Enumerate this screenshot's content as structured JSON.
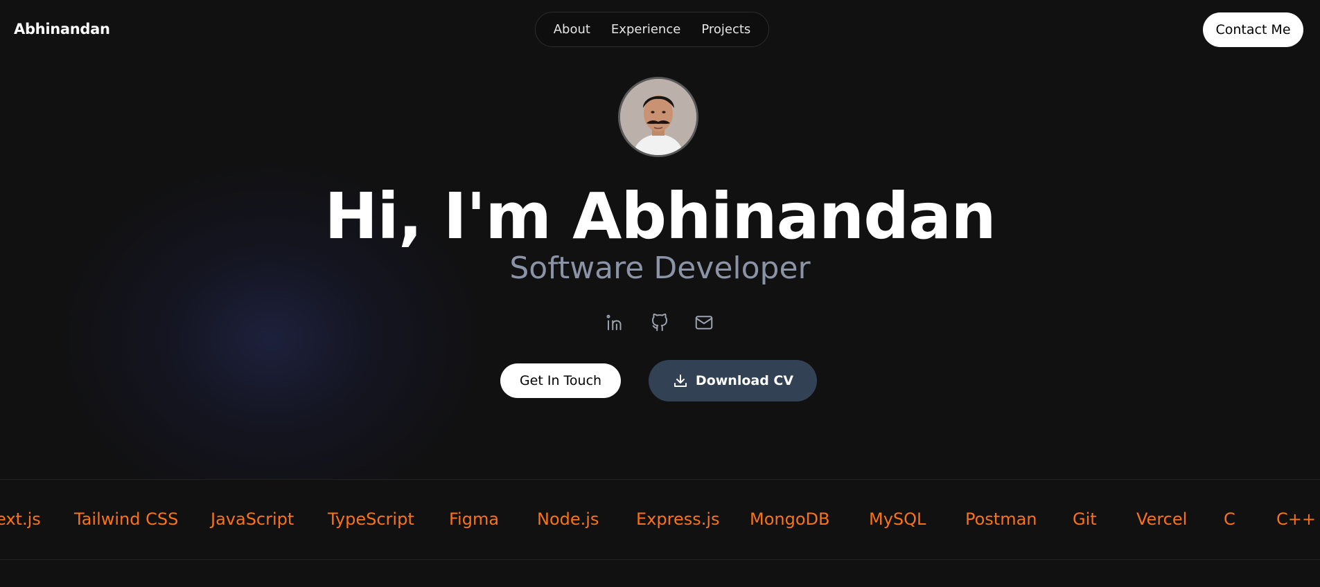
{
  "header": {
    "brand": "Abhinandan",
    "nav": [
      {
        "label": "About"
      },
      {
        "label": "Experience"
      },
      {
        "label": "Projects"
      }
    ],
    "contact_label": "Contact Me"
  },
  "hero": {
    "headline": "Hi, I'm Abhinandan",
    "subtitle": "Software Developer",
    "socials": [
      {
        "icon": "linkedin-icon"
      },
      {
        "icon": "github-icon"
      },
      {
        "icon": "mail-icon"
      }
    ],
    "primary_button": "Get In Touch",
    "secondary_button": "Download CV",
    "secondary_button_icon": "download-icon"
  },
  "skills": [
    "ext.js",
    "Tailwind CSS",
    "JavaScript",
    "TypeScript",
    "Figma",
    "Node.js",
    "Express.js",
    "MongoDB",
    "MySQL",
    "Postman",
    "Git",
    "Vercel",
    "C",
    "C++"
  ],
  "colors": {
    "background": "#111112",
    "accent_skill": "#f97316",
    "subtitle": "#8b93a6",
    "cv_button": "#334155"
  }
}
